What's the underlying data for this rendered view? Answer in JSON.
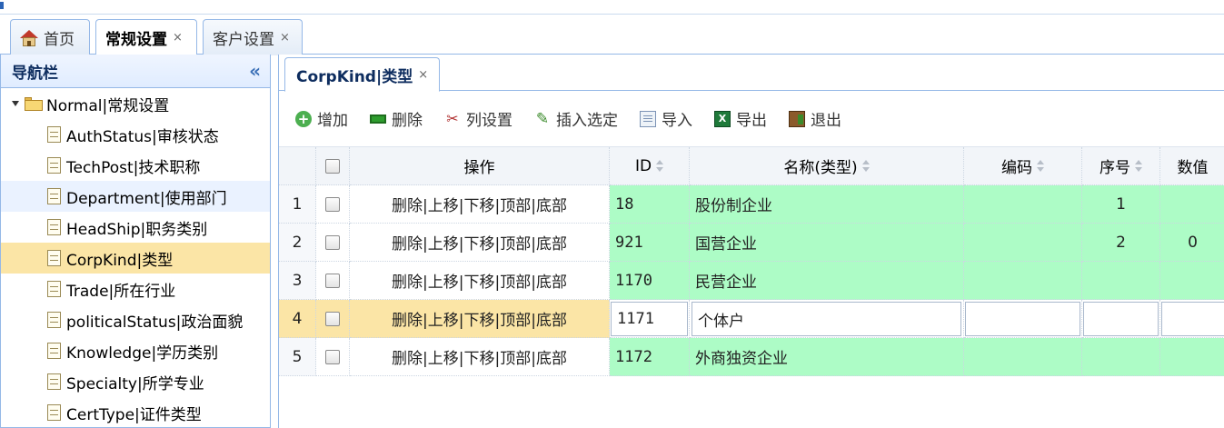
{
  "tabs": [
    {
      "label": "首页",
      "closable": false
    },
    {
      "label": "常规设置",
      "closable": true
    },
    {
      "label": "客户设置",
      "closable": true
    }
  ],
  "tab_close_glyph": "×",
  "sidebar": {
    "title": "导航栏",
    "collapse_glyph": "«",
    "root": "Normal|常规设置",
    "items": [
      {
        "label": "AuthStatus|审核状态"
      },
      {
        "label": "TechPost|技术职称"
      },
      {
        "label": "Department|使用部门"
      },
      {
        "label": "HeadShip|职务类别"
      },
      {
        "label": "CorpKind|类型"
      },
      {
        "label": "Trade|所在行业"
      },
      {
        "label": "politicalStatus|政治面貌"
      },
      {
        "label": "Knowledge|学历类别"
      },
      {
        "label": "Specialty|所学专业"
      },
      {
        "label": "CertType|证件类型"
      }
    ],
    "selected_item": "CorpKind|类型"
  },
  "inner_tab": {
    "label": "CorpKind|类型"
  },
  "toolbar": {
    "add": "增加",
    "delete": "删除",
    "columns": "列设置",
    "insert": "插入选定",
    "import": "导入",
    "export": "导出",
    "exit": "退出"
  },
  "grid": {
    "headers": {
      "ops": "操作",
      "id": "ID",
      "name": "名称(类型)",
      "code": "编码",
      "seq": "序号",
      "value": "数值"
    },
    "rows": [
      {
        "num": "1",
        "ops": "删除|上移|下移|顶部|底部",
        "id": "18",
        "name": "股份制企业",
        "code": "",
        "seq": "1",
        "value": ""
      },
      {
        "num": "2",
        "ops": "删除|上移|下移|顶部|底部",
        "id": "921",
        "name": "国营企业",
        "code": "",
        "seq": "2",
        "value": "0"
      },
      {
        "num": "3",
        "ops": "删除|上移|下移|顶部|底部",
        "id": "1170",
        "name": "民营企业",
        "code": "",
        "seq": "",
        "value": ""
      },
      {
        "num": "4",
        "ops": "删除|上移|下移|顶部|底部",
        "id": "1171",
        "name": "个体户",
        "code": "",
        "seq": "",
        "value": ""
      },
      {
        "num": "5",
        "ops": "删除|上移|下移|顶部|底部",
        "id": "1172",
        "name": "外商独资企业",
        "code": "",
        "seq": "",
        "value": ""
      }
    ],
    "editing_row": "4"
  },
  "colors": {
    "accent_border": "#95b8e7",
    "row_green": "#adfcc6",
    "selected_yellow": "#fbe5a6"
  }
}
